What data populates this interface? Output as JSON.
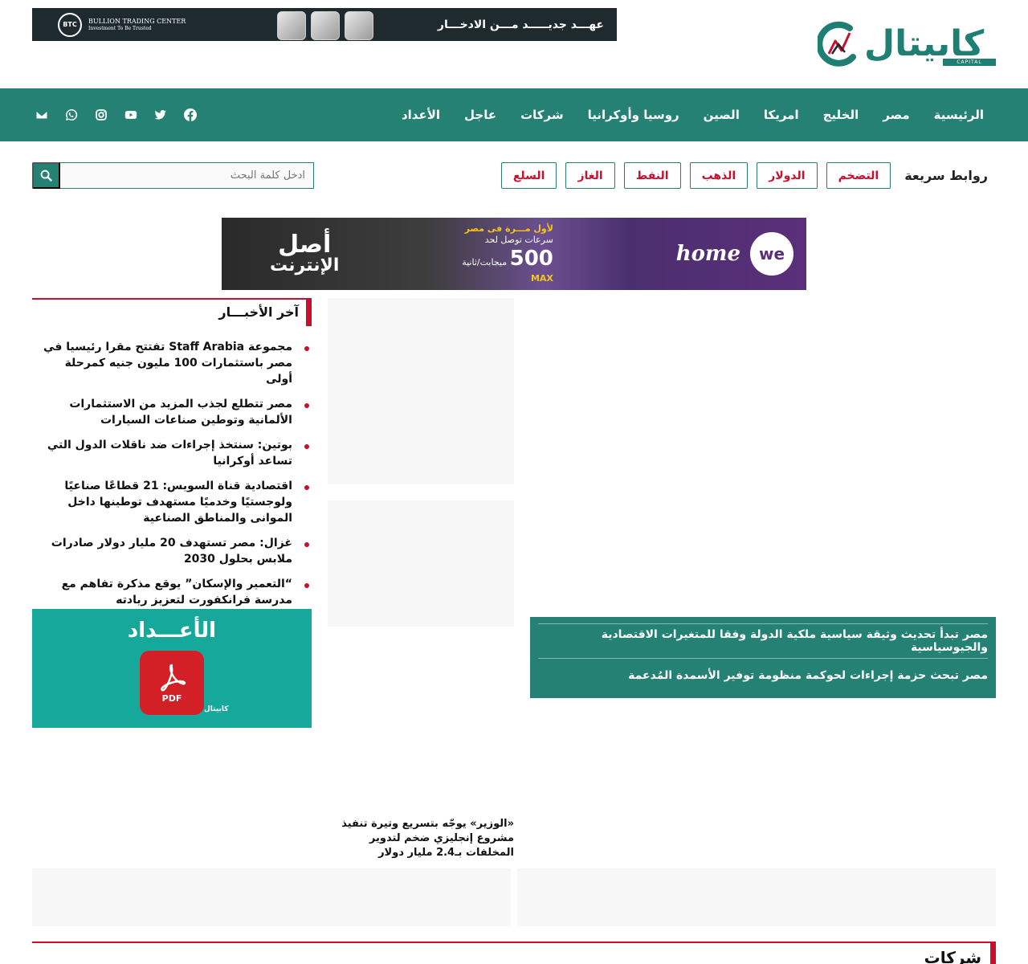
{
  "brand": {
    "name": "كابيتال",
    "sub": "CAPITAL",
    "accent_color": "#258173",
    "red_color": "#c8102e"
  },
  "top_banner": {
    "tagline": "عهـــد جديـــــد مـــن الادخـــار",
    "company": "BULLION TRADING CENTER",
    "slogan": "Investment To Be Trusted",
    "btc": "BTC"
  },
  "nav": {
    "items": [
      "الرئيسية",
      "مصر",
      "الخليج",
      "امريكا",
      "الصين",
      "روسيا وأوكرانيا",
      "شركات",
      "عاجل",
      "الأعداد"
    ],
    "social": [
      "facebook-icon",
      "twitter-icon",
      "youtube-icon",
      "instagram-icon",
      "whatsapp-icon",
      "email-icon"
    ]
  },
  "quick_links": {
    "title": "روابط سريعة",
    "items": [
      "التضخم",
      "الدولار",
      "الذهب",
      "النفط",
      "الغاز",
      "السلع"
    ]
  },
  "search": {
    "placeholder": "ادخل كلمة البحث"
  },
  "mid_ad": {
    "brand": "we",
    "product": "home",
    "headline": "لأول مـــرة فى مصر",
    "speed_line": "سرعات توصل لحد",
    "speed_value": "500",
    "speed_unit": "ميجابت/ثانية",
    "speed_tier": "MAX",
    "slogan_1": "أصل",
    "slogan_2": "الإنترنت"
  },
  "latest": {
    "title": "آخر الأخبـــار",
    "items": [
      "مجموعة Staff Arabia تفتتح مقرا رئيسيا في مصر باستثمارات 100 مليون جنيه كمرحلة أولى",
      "مصر تتطلع لجذب المزيد من الاستثمارات الألمانية وتوطين صناعات السيارات",
      "بوتين: سنتخذ إجراءات ضد ناقلات الدول التي تساعد أوكرانيا",
      "اقتصادية قناة السويس: 21 قطاعًا صناعيًا ولوجستيًا وخدميًا مستهدف توطينها داخل الموانى والمناطق الصناعية",
      "غزال: مصر تستهدف 20 مليار دولار صادرات ملابس بحلول 2030",
      "“التعمير والإسكان” يوقع مذكرة تفاهم مع مدرسة فرانكفورت لتعزيز ريادته"
    ]
  },
  "issues_ad": {
    "title": "الأعـــداد",
    "pdf_label": "PDF",
    "logo": "كابيتال"
  },
  "featured": {
    "items": [
      "مصر تبدأ تحديث وثيقة سياسية ملكية الدولة وفقا للمتغيرات الاقتصادية والجيوسياسية",
      "مصر تبحث حزمة إجراءات لحوكمة منظومة توفير الأسمدة المُدعمة"
    ]
  },
  "caption": {
    "text": "«الوزير» يوجّه بتسريع وتيرة تنفيذ مشروع إنجليزي ضخم لتدوير المخلفات بـ2.4 مليار دولار"
  },
  "section": {
    "title": "شركات"
  }
}
